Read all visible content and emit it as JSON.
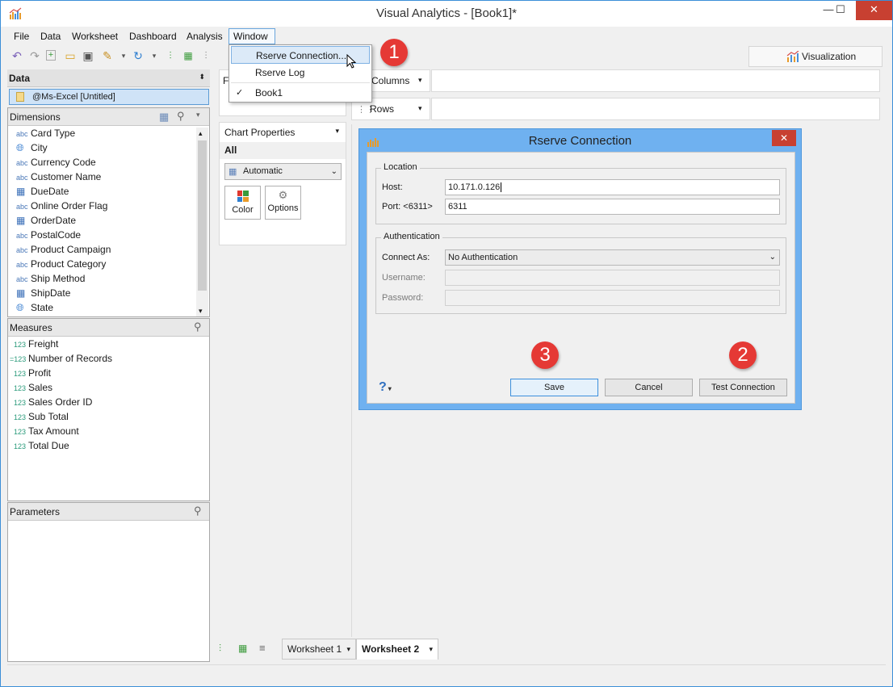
{
  "window": {
    "title": "Visual Analytics - [Book1]*",
    "minimize": "—",
    "maximize": "☐",
    "close": "✕"
  },
  "menubar": {
    "items": [
      "File",
      "Data",
      "Worksheet",
      "Dashboard",
      "Analysis",
      "Window"
    ]
  },
  "window_menu": {
    "items": [
      {
        "label": "Rserve Connection...",
        "highlighted": true,
        "checked": false
      },
      {
        "label": "Rserve Log",
        "highlighted": false,
        "checked": false
      },
      {
        "label": "Book1",
        "highlighted": false,
        "checked": true
      }
    ]
  },
  "visualization_tab": {
    "label": "Visualization"
  },
  "data_panel": {
    "header": "Data",
    "source": "@Ms-Excel [Untitled]",
    "dimensions_header": "Dimensions",
    "dimensions": [
      {
        "label": "Card Type",
        "icon": "abc"
      },
      {
        "label": "City",
        "icon": "globe-icon"
      },
      {
        "label": "Currency Code",
        "icon": "abc"
      },
      {
        "label": "Customer Name",
        "icon": "abc"
      },
      {
        "label": "DueDate",
        "icon": "calendar-icon"
      },
      {
        "label": "Online Order Flag",
        "icon": "abc"
      },
      {
        "label": "OrderDate",
        "icon": "calendar-icon"
      },
      {
        "label": "PostalCode",
        "icon": "abc"
      },
      {
        "label": "Product Campaign",
        "icon": "abc"
      },
      {
        "label": "Product Category",
        "icon": "abc"
      },
      {
        "label": "Ship Method",
        "icon": "abc"
      },
      {
        "label": "ShipDate",
        "icon": "calendar-icon"
      },
      {
        "label": "State",
        "icon": "globe-icon"
      }
    ],
    "measures_header": "Measures",
    "measures": [
      {
        "label": "Freight",
        "icon": "123"
      },
      {
        "label": "Number of Records",
        "icon": "=123"
      },
      {
        "label": "Profit",
        "icon": "123"
      },
      {
        "label": "Sales",
        "icon": "123"
      },
      {
        "label": "Sales Order ID",
        "icon": "123"
      },
      {
        "label": "Sub Total",
        "icon": "123"
      },
      {
        "label": "Tax Amount",
        "icon": "123"
      },
      {
        "label": "Total Due",
        "icon": "123"
      }
    ],
    "parameters_header": "Parameters"
  },
  "shelves": {
    "columns": "Columns",
    "rows": "Rows",
    "filters_initial": "F"
  },
  "chart_properties": {
    "header": "Chart Properties",
    "scope": "All",
    "type_selected": "Automatic",
    "color_label": "Color",
    "options_label": "Options"
  },
  "dialog": {
    "title": "Rserve Connection",
    "location_legend": "Location",
    "host_label": "Host:",
    "host_value": "10.171.0.126",
    "port_label": "Port: <6311>",
    "port_value": "6311",
    "auth_legend": "Authentication",
    "connect_as_label": "Connect As:",
    "connect_as_value": "No Authentication",
    "username_label": "Username:",
    "password_label": "Password:",
    "help": "?",
    "save": "Save",
    "cancel": "Cancel",
    "test": "Test Connection"
  },
  "callouts": {
    "one": "1",
    "two": "2",
    "three": "3"
  },
  "sheets": {
    "tab1": "Worksheet 1",
    "tab2": "Worksheet 2"
  },
  "colors": {
    "accent": "#3b8fd8",
    "callout": "#e53935",
    "dialog_frame": "#6fb1f0"
  }
}
